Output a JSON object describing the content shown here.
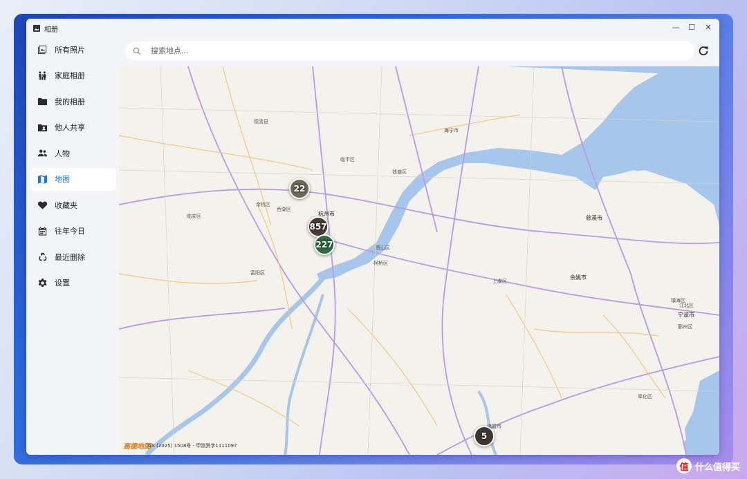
{
  "window": {
    "title": "相册",
    "controls": {
      "minimize": "—",
      "maximize": "☐",
      "close": "✕"
    }
  },
  "sidebar": {
    "items": [
      {
        "label": "所有照片",
        "icon": "photos-icon"
      },
      {
        "label": "家庭相册",
        "icon": "family-icon"
      },
      {
        "label": "我的相册",
        "icon": "folder-icon"
      },
      {
        "label": "他人共享",
        "icon": "shared-folder-icon"
      },
      {
        "label": "人物",
        "icon": "people-icon"
      },
      {
        "label": "地图",
        "icon": "map-icon",
        "active": true
      },
      {
        "label": "收藏夹",
        "icon": "heart-icon"
      },
      {
        "label": "往年今日",
        "icon": "calendar-icon"
      },
      {
        "label": "最近删除",
        "icon": "recycle-icon"
      },
      {
        "label": "设置",
        "icon": "gear-icon"
      }
    ]
  },
  "search": {
    "placeholder": "搜索地点..."
  },
  "map": {
    "clusters": [
      {
        "count": "22",
        "color": "#6b6b55"
      },
      {
        "count": "857",
        "color": "#4a3b36"
      },
      {
        "count": "227",
        "color": "#2f6b45"
      },
      {
        "count": "5",
        "color": "#3d3535"
      }
    ],
    "cities": [
      {
        "name": "杭州市",
        "major": true
      },
      {
        "name": "萧山区"
      },
      {
        "name": "上虞区"
      },
      {
        "name": "余姚市",
        "major": true
      },
      {
        "name": "慈溪市",
        "major": true
      },
      {
        "name": "宁波市",
        "major": true
      },
      {
        "name": "镇海区"
      },
      {
        "name": "江北区"
      },
      {
        "name": "鄞州区"
      },
      {
        "name": "余杭区"
      },
      {
        "name": "西湖区"
      },
      {
        "name": "临平区"
      },
      {
        "name": "海宁市"
      },
      {
        "name": "柯桥区"
      },
      {
        "name": "富阳区"
      },
      {
        "name": "临安区"
      },
      {
        "name": "德清县"
      },
      {
        "name": "奉化区"
      },
      {
        "name": "钱塘区"
      },
      {
        "name": "诸暨市"
      }
    ],
    "attribution": "GS (2025) 1508号 - 甲测资字1111097",
    "logo_text": "高德地图"
  },
  "site_watermark": {
    "badge": "值",
    "text": "什么值得买"
  },
  "colors": {
    "accent": "#1a73e8",
    "water": "#a7c6ec",
    "road_major": "#b69be6",
    "road_minor": "#f5c77a"
  }
}
